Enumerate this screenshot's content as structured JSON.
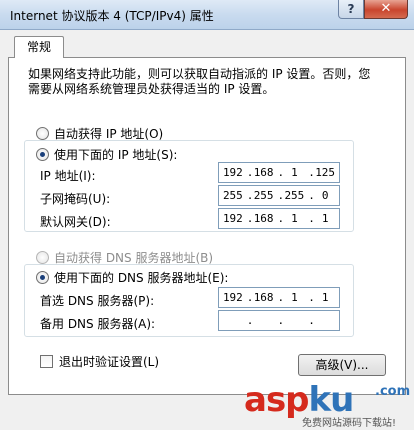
{
  "window": {
    "title": "Internet 协议版本 4 (TCP/IPv4) 属性",
    "help_label": "?",
    "close_label": "✕"
  },
  "tabs": [
    {
      "label": "常规"
    }
  ],
  "description": "如果网络支持此功能，则可以获取自动指派的 IP 设置。否则，您需要从网络系统管理员处获得适当的 IP 设置。",
  "ip_section": {
    "auto_label": "自动获得 IP 地址(O)",
    "manual_label": "使用下面的 IP 地址(S):",
    "selected": "manual",
    "fields": [
      {
        "label": "IP 地址(I):",
        "octets": [
          "192",
          "168",
          "1",
          "125"
        ]
      },
      {
        "label": "子网掩码(U):",
        "octets": [
          "255",
          "255",
          "255",
          "0"
        ]
      },
      {
        "label": "默认网关(D):",
        "octets": [
          "192",
          "168",
          "1",
          "1"
        ]
      }
    ]
  },
  "dns_section": {
    "auto_label": "自动获得 DNS 服务器地址(B)",
    "manual_label": "使用下面的 DNS 服务器地址(E):",
    "selected": "manual",
    "fields": [
      {
        "label": "首选 DNS 服务器(P):",
        "octets": [
          "192",
          "168",
          "1",
          "1"
        ]
      },
      {
        "label": "备用 DNS 服务器(A):",
        "octets": [
          "",
          "",
          "",
          ""
        ]
      }
    ]
  },
  "validate_label": "退出时验证设置(L)",
  "validate_checked": false,
  "advanced_button": "高级(V)...",
  "watermark": {
    "brand": "aspku",
    "suffix": ".com",
    "tagline": "免费网站源码下载站!"
  }
}
